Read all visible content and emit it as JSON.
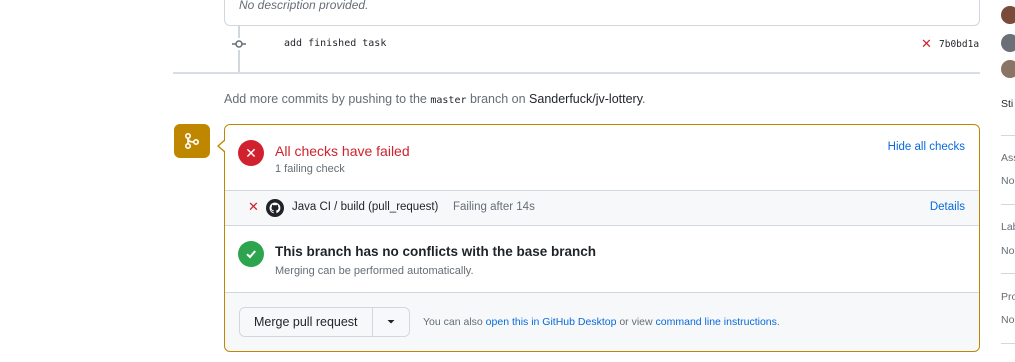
{
  "description": {
    "text": "No description provided."
  },
  "commit": {
    "message": "add finished task",
    "status_icon": "x-icon",
    "sha": "7b0bd1a"
  },
  "push_hint": {
    "prefix": "Add more commits by pushing to the ",
    "branch": "master",
    "middle": " branch on ",
    "repo": "Sanderfuck/jv-lottery",
    "suffix": "."
  },
  "checks": {
    "title": "All checks have failed",
    "subtitle": "1 failing check",
    "toggle_label": "Hide all checks",
    "items": [
      {
        "name": "Java CI / build (pull_request)",
        "status": "Failing after 14s",
        "details_label": "Details"
      }
    ]
  },
  "conflicts": {
    "title": "This branch has no conflicts with the base branch",
    "subtitle": "Merging can be performed automatically."
  },
  "merge": {
    "button_label": "Merge pull request",
    "hint_prefix": "You can also ",
    "hint_link1": "open this in GitHub Desktop",
    "hint_middle": " or view ",
    "hint_link2": "command line instructions",
    "hint_suffix": "."
  },
  "sidebar": {
    "labels": [
      "Sti",
      "Ass",
      "No",
      "Lab",
      "No",
      "Pro",
      "No"
    ]
  },
  "colors": {
    "danger": "#cf222e",
    "success": "#2da44e",
    "attention": "#bf8700",
    "accent": "#0969da"
  }
}
